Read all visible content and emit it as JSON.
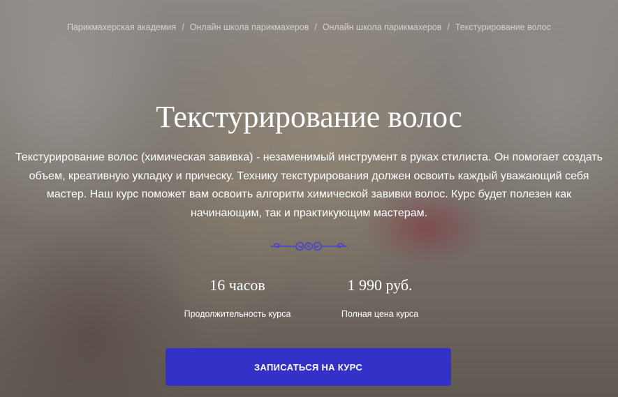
{
  "breadcrumb": {
    "items": [
      {
        "label": "Парикмахерская академия"
      },
      {
        "label": "Онлайн школа парикмахеров"
      },
      {
        "label": "Онлайн школа парикмахеров"
      },
      {
        "label": "Текстурирование волос"
      }
    ],
    "separator": "/"
  },
  "hero": {
    "title": "Текстурирование волос",
    "description": "Текстурирование волос (химическая завивка) - незаменимый инструмент в руках стилиста. Он помогает создать объем, креативную укладку и прическу. Технику текстурирования должен освоить каждый уважающий себя мастер. Наш курс поможет вам освоить алгоритм химической завивки волос. Курс будет полезен как начинающим, так и практикующим мастерам.",
    "divider_icon": "ornament-flourish-icon",
    "accent_color": "#3431c8",
    "ornament_color": "#4b44c8"
  },
  "stats": {
    "duration": {
      "value": "16 часов",
      "label": "Продолжительность курса"
    },
    "price": {
      "value": "1 990 руб.",
      "label": "Полная цена курса"
    }
  },
  "cta": {
    "label": "ЗАПИСАТЬСЯ НА КУРС"
  }
}
